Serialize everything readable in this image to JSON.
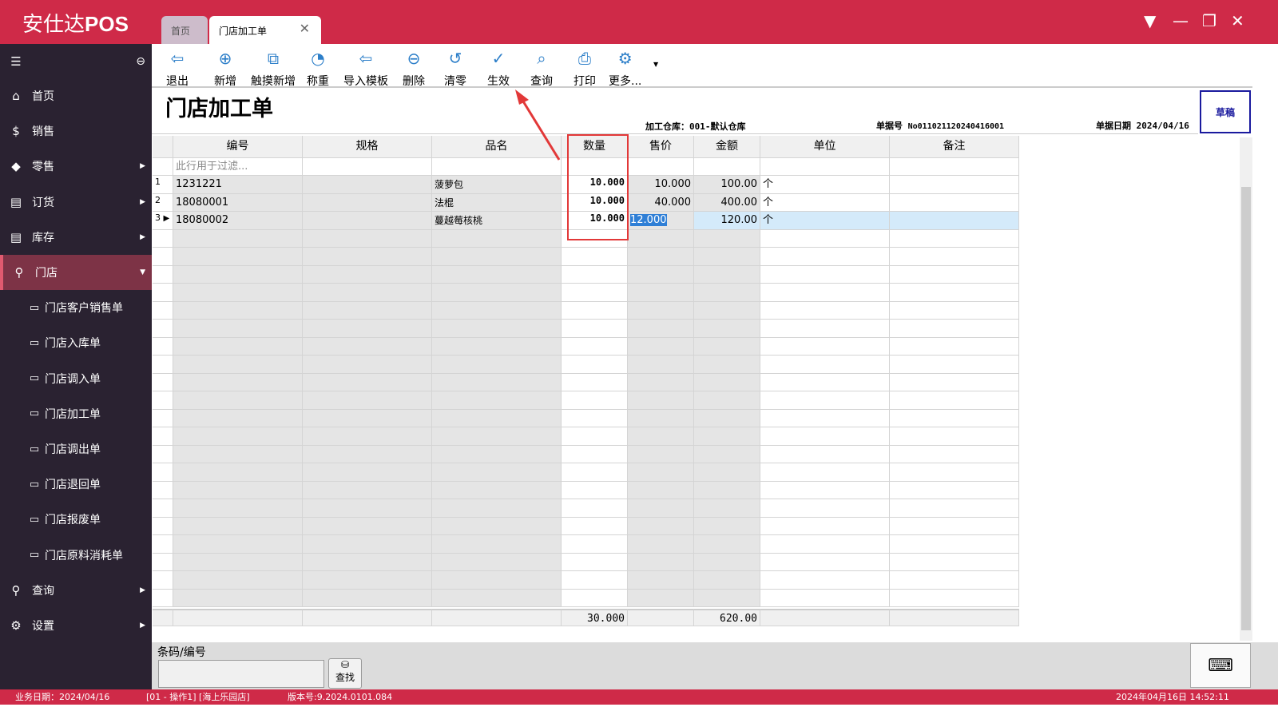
{
  "app": {
    "logo_cn": "安仕达",
    "logo_en": "POS"
  },
  "tabs": [
    {
      "label": "首页"
    },
    {
      "label": "门店加工单"
    }
  ],
  "sidebar": {
    "items": [
      {
        "label": "首页",
        "icon": "home-icon",
        "glyph": "⌂"
      },
      {
        "label": "销售",
        "icon": "dollar-icon",
        "glyph": "$"
      },
      {
        "label": "零售",
        "icon": "tag-icon",
        "glyph": "◆"
      },
      {
        "label": "订货",
        "icon": "box-icon",
        "glyph": "▤"
      },
      {
        "label": "库存",
        "icon": "storage-icon",
        "glyph": "▤"
      },
      {
        "label": "门店",
        "icon": "search-icon",
        "glyph": "⚲"
      },
      {
        "label": "门店客户销售单"
      },
      {
        "label": "门店入库单"
      },
      {
        "label": "门店调入单"
      },
      {
        "label": "门店加工单"
      },
      {
        "label": "门店调出单"
      },
      {
        "label": "门店退回单"
      },
      {
        "label": "门店报废单"
      },
      {
        "label": "门店原料消耗单"
      },
      {
        "label": "查询",
        "icon": "search-icon",
        "glyph": "⚲"
      },
      {
        "label": "设置",
        "icon": "gear-icon",
        "glyph": "⚙"
      }
    ]
  },
  "toolbar": [
    {
      "label": "退出",
      "glyph": "⇦"
    },
    {
      "label": "新增",
      "glyph": "⊕"
    },
    {
      "label": "触摸新增",
      "glyph": "⧉"
    },
    {
      "label": "称重",
      "glyph": "◔"
    },
    {
      "label": "导入模板",
      "glyph": "⇦"
    },
    {
      "label": "删除",
      "glyph": "⊖"
    },
    {
      "label": "清零",
      "glyph": "↺"
    },
    {
      "label": "生效",
      "glyph": "✓"
    },
    {
      "label": "查询",
      "glyph": "⌕"
    },
    {
      "label": "打印",
      "glyph": "⎙"
    },
    {
      "label": "更多...",
      "glyph": "⚙"
    }
  ],
  "page": {
    "title": "门店加工单",
    "warehouse": "加工仓库：001-默认仓库",
    "doc_no_label": "单据号",
    "doc_no": "No011021120240416001",
    "doc_date_label": "单据日期",
    "doc_date": "2024/04/16",
    "status": "草稿"
  },
  "table": {
    "headers": [
      "编号",
      "规格",
      "品名",
      "数量",
      "售价",
      "金额",
      "单位",
      "备注"
    ],
    "filter_placeholder": "此行用于过滤...",
    "rows": [
      {
        "n": "1",
        "code": "1231221",
        "spec": "",
        "name": "菠萝包",
        "qty": "10.000",
        "price": "10.000",
        "amount": "100.00",
        "unit": "个",
        "note": ""
      },
      {
        "n": "2",
        "code": "18080001",
        "spec": "",
        "name": "法棍",
        "qty": "10.000",
        "price": "40.000",
        "amount": "400.00",
        "unit": "个",
        "note": ""
      },
      {
        "n": "3",
        "code": "18080002",
        "spec": "",
        "name": "蔓越莓核桃",
        "qty": "10.000",
        "price": "12.000",
        "amount": "120.00",
        "unit": "个",
        "note": ""
      }
    ],
    "total_qty": "30.000",
    "total_amount": "620.00"
  },
  "bottom": {
    "barcode_label": "条码/编号",
    "barcode_value": "",
    "find_label": "查找"
  },
  "status": {
    "biz_date": "业务日期：2024/04/16",
    "operator": "[01 - 操作1]  [海上乐园店]",
    "version": "版本号:9.2024.0101.084",
    "datetime": "2024年04月16日 14:52:11"
  },
  "colors": {
    "brand": "#cf2a48",
    "sidebar": "#2a2231",
    "highlight": "#e23838"
  }
}
